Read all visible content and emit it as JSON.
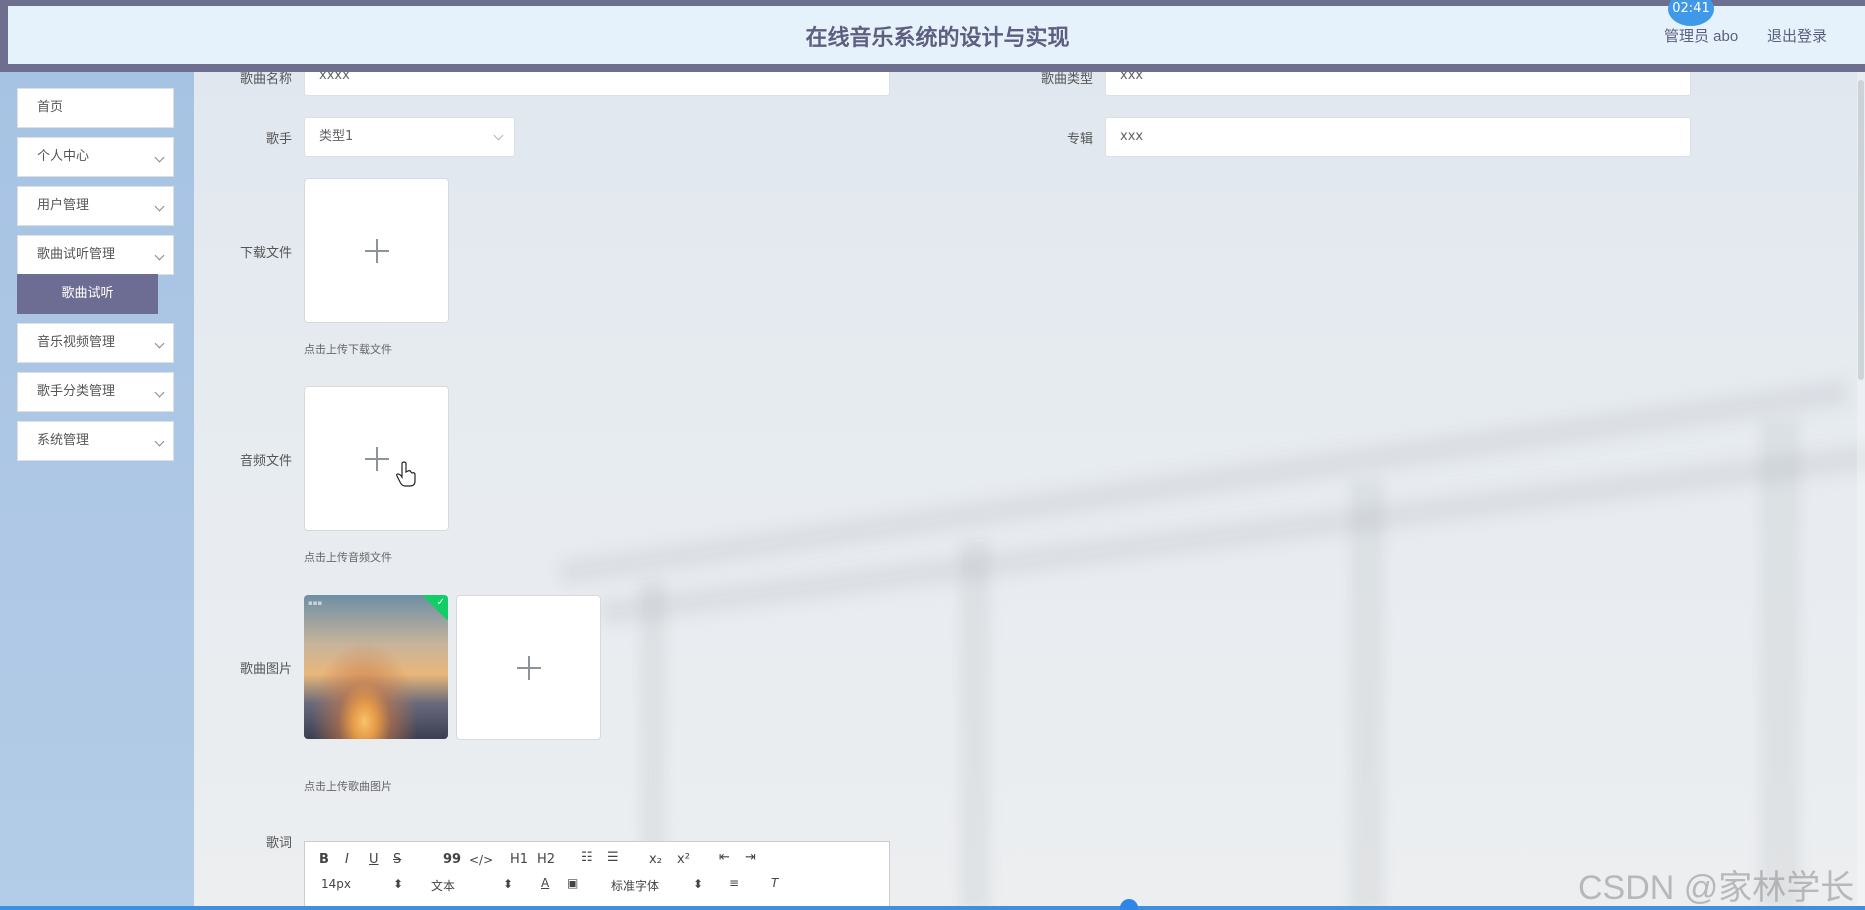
{
  "header": {
    "title": "在线音乐系统的设计与实现",
    "user": "管理员 abo",
    "logout": "退出登录",
    "clock": "02:41"
  },
  "sidebar": {
    "items": [
      {
        "label": "首页"
      },
      {
        "label": "个人中心"
      },
      {
        "label": "用户管理"
      },
      {
        "label": "歌曲试听管理"
      },
      {
        "label": "音乐视频管理"
      },
      {
        "label": "歌手分类管理"
      },
      {
        "label": "系统管理"
      }
    ],
    "active_sub": "歌曲试听"
  },
  "form": {
    "song_name_label": "歌曲名称",
    "song_name_value": "xxxx",
    "song_type_label": "歌曲类型",
    "song_type_value": "xxx",
    "singer_label": "歌手",
    "singer_value": "类型1",
    "album_label": "专辑",
    "album_value": "xxx",
    "download_label": "下载文件",
    "download_hint": "点击上传下载文件",
    "audio_label": "音频文件",
    "audio_hint": "点击上传音频文件",
    "image_label": "歌曲图片",
    "image_hint": "点击上传歌曲图片",
    "lyrics_label": "歌词"
  },
  "editor": {
    "bold": "B",
    "italic": "I",
    "underline": "U",
    "strike": "S",
    "quote": "99",
    "code": "</>",
    "h1": "H1",
    "h2": "H2",
    "subscript": "x₂",
    "superscript": "x²",
    "font_size": "14px",
    "text_type": "文本",
    "font_family": "标准字体"
  },
  "watermark": "CSDN @家林学长"
}
